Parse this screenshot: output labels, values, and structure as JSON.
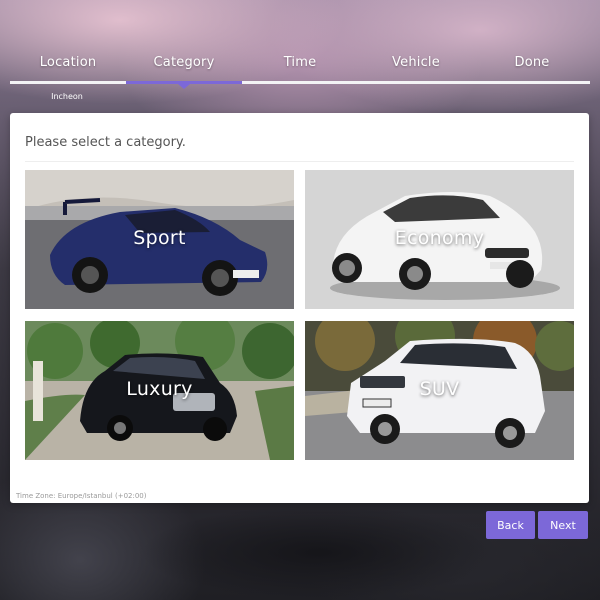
{
  "steps": [
    {
      "label": "Location"
    },
    {
      "label": "Category"
    },
    {
      "label": "Time"
    },
    {
      "label": "Vehicle"
    },
    {
      "label": "Done"
    }
  ],
  "active_step": "Category",
  "location_selected": "Incheon",
  "prompt": "Please select a category.",
  "categories": [
    {
      "label": "Sport"
    },
    {
      "label": "Economy"
    },
    {
      "label": "Luxury"
    },
    {
      "label": "SUV"
    }
  ],
  "timezone": "Time Zone: Europe/Istanbul (+02:00)",
  "buttons": {
    "back": "Back",
    "next": "Next"
  },
  "colors": {
    "accent": "#7c68d8",
    "card": "#ffffff"
  }
}
